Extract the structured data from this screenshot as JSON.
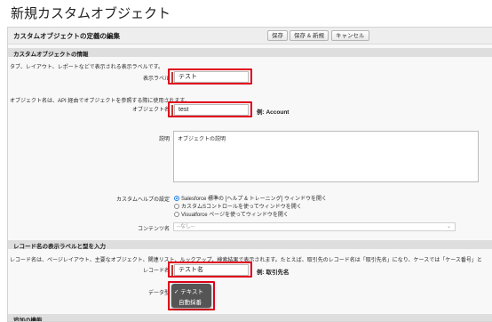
{
  "page": {
    "title": "新規カスタムオブジェクト"
  },
  "header": {
    "title": "カスタムオブジェクトの定義の編集",
    "buttons": {
      "save": "保存",
      "save_new": "保存 & 新規",
      "cancel": "キャンセル"
    }
  },
  "info_section": {
    "title": "カスタムオブジェクトの情報",
    "desc1": "タブ、レイアウト、レポートなどで表示される表示ラベルです。",
    "label_label": "表示ラベル",
    "label_value": "テスト",
    "desc2": "オブジェクト名は、API 経由でオブジェクトを参照する際に使用されます。",
    "name_label": "オブジェクト名",
    "name_value": "test",
    "name_example": "例: Account",
    "description_label": "説明",
    "description_value": "オブジェクトの説明",
    "help_label": "カスタムヘルプの設定",
    "help_options": [
      "Salesforce 標準の [ヘルプ & トレーニング] ウィンドウを開く",
      "カスタムSコントロールを使ってウィンドウを開く",
      "Visualforce ページを使ってウィンドウを開く"
    ],
    "content_label": "コンテンツ名",
    "content_value": "--なし--"
  },
  "record_section": {
    "title": "レコード名の表示ラベルと型を入力",
    "desc": "レコード名は、ページレイアウト、主要なオブジェクト、関連リスト、ルックアップ、検索結果で表示されます。たとえば、取引先のレコード名は「取引先名」になり、ケースでは「ケース番号」と",
    "record_label": "レコード名",
    "record_value": "テスト名",
    "record_example": "例: 取引先名",
    "datatype_label": "データ型",
    "datatype_options": [
      "✓ テキスト",
      "自動採番"
    ]
  },
  "extra_section": {
    "title": "追加の機能"
  }
}
